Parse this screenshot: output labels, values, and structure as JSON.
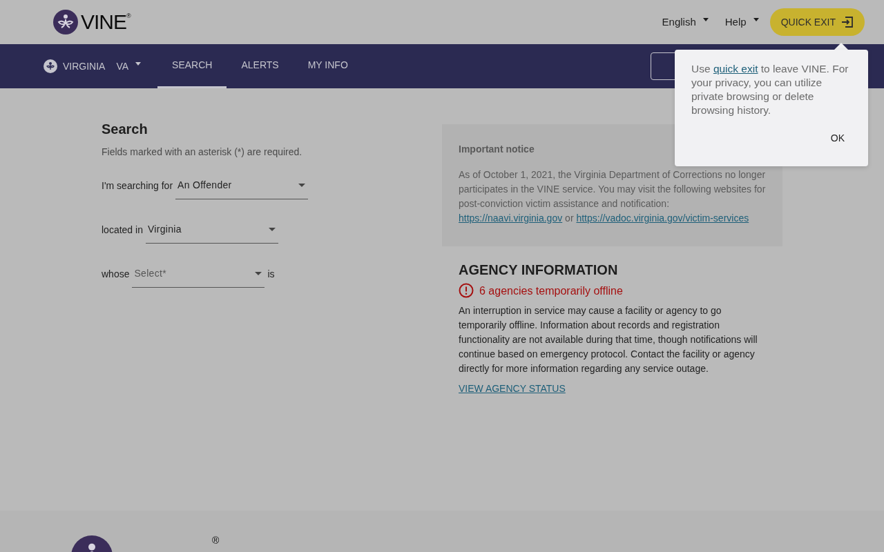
{
  "header": {
    "logo": "VINE",
    "logo_mark": "®",
    "language": "English",
    "help": "Help",
    "quick_exit": "QUICK EXIT"
  },
  "nav": {
    "state": "VIRGINIA",
    "state_abbr": "VA",
    "tabs": [
      {
        "label": "SEARCH",
        "selected": true
      },
      {
        "label": "ALERTS",
        "selected": false
      },
      {
        "label": "MY INFO",
        "selected": false
      }
    ]
  },
  "search": {
    "title": "Search",
    "hint": "Fields marked with an asterisk (*) are required.",
    "rows": [
      {
        "label": "I'm searching for",
        "value": "An Offender"
      },
      {
        "label": "located in",
        "value": "Virginia"
      },
      {
        "label": "whose",
        "placeholder": "Select*",
        "suffix": "is"
      }
    ]
  },
  "notice": {
    "title": "Important notice",
    "text": "As of October 1, 2021, the Virginia Department of Corrections no longer participates in the VINE service. You may visit the following websites for post-conviction victim assistance and notification:",
    "links": [
      "https://naavi.virginia.gov",
      "https://vadoc.virginia.gov/victim-services"
    ],
    "joiner": "or"
  },
  "agency": {
    "title": "AGENCY INFORMATION",
    "alert": "6 agencies temporarily offline",
    "text": "An interruption in service may cause a facility or agency to go temporarily offline. Information about records and registration functionality are not available during that time, though notifications will continue based on emergency protocol. Contact the facility or agency directly for more information regarding any service outage.",
    "link": "VIEW AGENCY STATUS"
  },
  "popover": {
    "before": "Use",
    "link": "quick exit",
    "after": "to leave VINE. For your privacy, you can utilize private browsing or delete browsing history.",
    "ok": "OK"
  },
  "footer": {
    "logo_mark": "®"
  }
}
